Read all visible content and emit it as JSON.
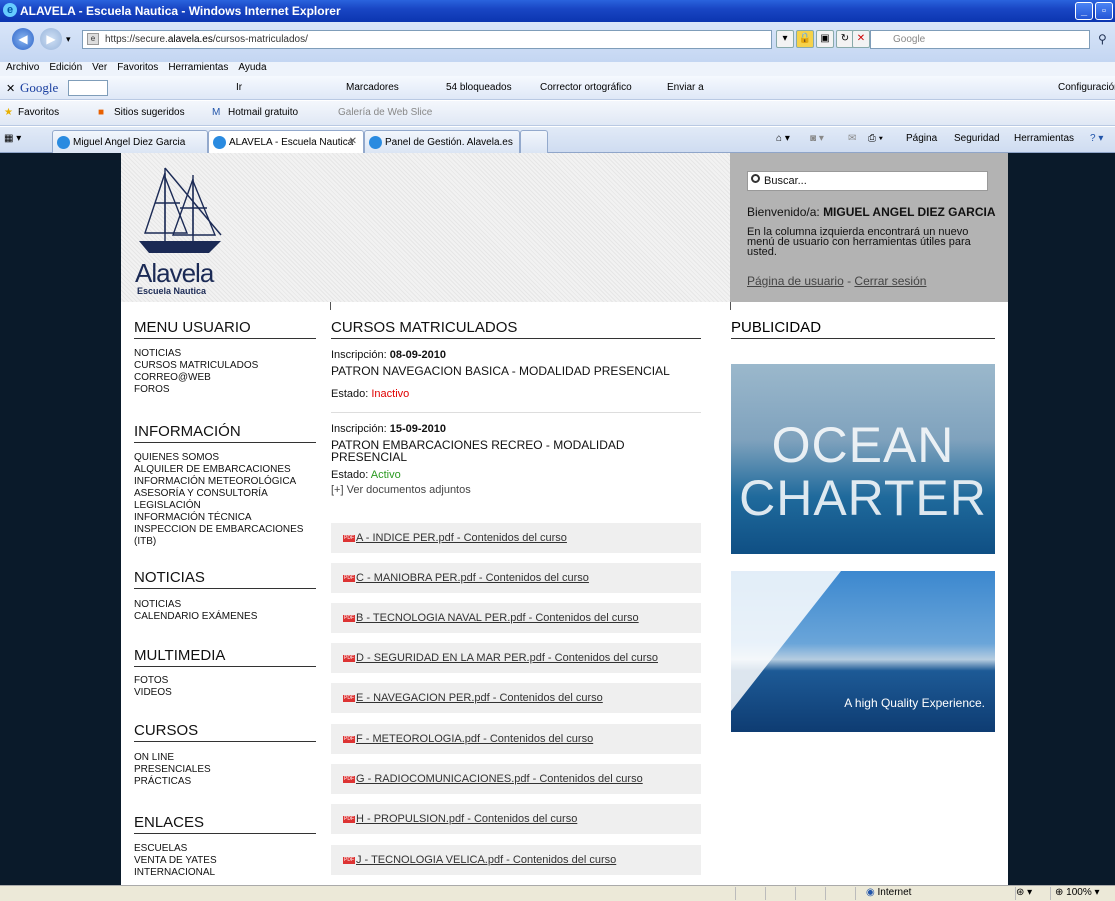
{
  "window": {
    "title": "ALAVELA - Escuela Nautica - Windows Internet Explorer"
  },
  "address": {
    "url_prefix": "https://secure.",
    "url_host": "alavela.es",
    "url_path": "/cursos-matriculados/",
    "search_placeholder": "Google"
  },
  "menubar": [
    "Archivo",
    "Edición",
    "Ver",
    "Favoritos",
    "Herramientas",
    "Ayuda"
  ],
  "google_toolbar": {
    "label": "Google",
    "go": "Ir",
    "bookmarks": "Marcadores",
    "blocked": "54 bloqueados",
    "spell": "Corrector ortográfico",
    "send": "Enviar a",
    "settings": "Configuración"
  },
  "favbar": {
    "favorites": "Favoritos",
    "suggested": "Sitios sugeridos",
    "hotmail": "Hotmail gratuito",
    "webslice": "Galería de Web Slice"
  },
  "tabs": [
    {
      "label": "Miguel Angel Diez Garcia"
    },
    {
      "label": "ALAVELA - Escuela Nautica"
    },
    {
      "label": "Panel de Gestión. Alavela.es"
    }
  ],
  "cmdbar": {
    "page": "Página",
    "security": "Seguridad",
    "tools": "Herramientas"
  },
  "site": {
    "logo_name": "Alavela",
    "logo_sub": "Escuela Nautica",
    "search_placeholder": "Buscar...",
    "welcome_prefix": "Bienvenido/a: ",
    "welcome_name": "MIGUEL ANGEL DIEZ GARCIA",
    "info": "En la columna izquierda encontrará un nuevo menú de usuario con herramientas útiles para usted.",
    "user_page": "Página de usuario",
    "link_sep": " - ",
    "logout": "Cerrar sesión"
  },
  "left_menu": [
    {
      "title": "MENU USUARIO",
      "items": [
        "NOTICIAS",
        "CURSOS MATRICULADOS",
        "CORREO@WEB",
        "FOROS"
      ]
    },
    {
      "title": "INFORMACIÓN",
      "items": [
        "QUIENES SOMOS",
        "ALQUILER DE EMBARCACIONES",
        "INFORMACIÓN METEOROLÓGICA",
        "ASESORÍA Y CONSULTORÍA",
        "LEGISLACIÓN",
        "INFORMACIÓN TÉCNICA",
        "INSPECCION DE EMBARCACIONES",
        "(ITB)"
      ]
    },
    {
      "title": "NOTICIAS",
      "items": [
        "NOTICIAS",
        "CALENDARIO EXÁMENES"
      ]
    },
    {
      "title": "MULTIMEDIA",
      "items": [
        "FOTOS",
        "VIDEOS"
      ]
    },
    {
      "title": "CURSOS",
      "items": [
        "ON LINE",
        "PRESENCIALES",
        "PRÁCTICAS"
      ]
    },
    {
      "title": "ENLACES",
      "items": [
        "ESCUELAS",
        "VENTA DE YATES",
        "INTERNACIONAL"
      ]
    }
  ],
  "center": {
    "title": "CURSOS MATRICULADOS",
    "ins_label": "Inscripción: ",
    "estado_label": "Estado: ",
    "courses": [
      {
        "date": "08-09-2010",
        "name": "PATRON NAVEGACION BASICA - MODALIDAD PRESENCIAL",
        "status": "Inactivo"
      },
      {
        "date": "15-09-2010",
        "name": "PATRON EMBARCACIONES RECREO - MODALIDAD PRESENCIAL",
        "status": "Activo"
      }
    ],
    "docs_toggle": "[+] Ver documentos adjuntos",
    "pdf_badge": "PDF",
    "documents": [
      "A - INDICE PER.pdf - Contenidos del curso",
      "C - MANIOBRA PER.pdf - Contenidos del curso",
      "B - TECNOLOGIA NAVAL PER.pdf - Contenidos del curso",
      "D - SEGURIDAD EN LA MAR PER.pdf - Contenidos del curso",
      "E - NAVEGACION PER.pdf - Contenidos del curso",
      "F - METEOROLOGIA.pdf - Contenidos del curso",
      "G - RADIOCOMUNICACIONES.pdf - Contenidos del curso",
      "H - PROPULSION.pdf - Contenidos del curso",
      "J - TECNOLOGIA VELICA.pdf - Contenidos del curso"
    ]
  },
  "right": {
    "title": "PUBLICIDAD",
    "ad1_line1": "OCEAN",
    "ad1_line2": "CHARTER",
    "ad2_text": "A high Quality Experience."
  },
  "status": {
    "zone": "Internet",
    "zoom": "100%"
  },
  "colors": {
    "inactive": "#e00000",
    "active": "#2a9a20",
    "site_bg": "#0a1a2a"
  }
}
